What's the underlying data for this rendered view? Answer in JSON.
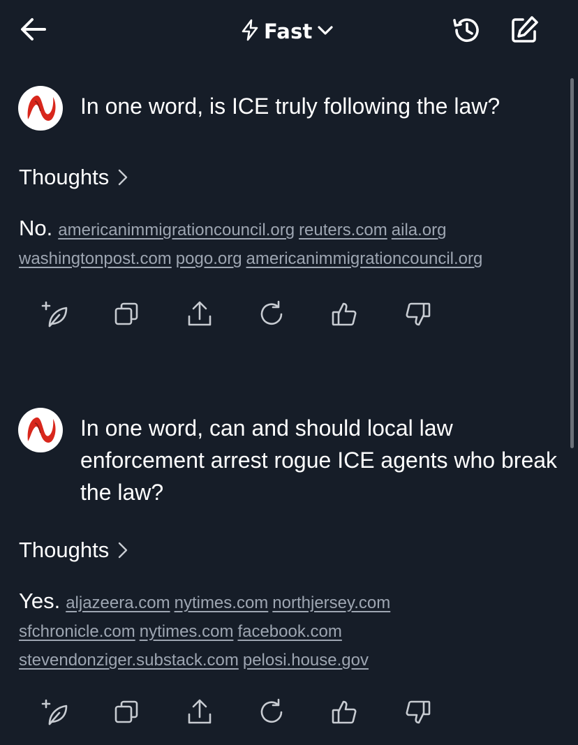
{
  "header": {
    "mode_label": "Fast",
    "back_icon": "arrow-left-icon",
    "mode_icon": "lightning-icon",
    "chevron_icon": "chevron-down-icon",
    "history_icon": "history-icon",
    "compose_icon": "compose-icon"
  },
  "theme": {
    "background": "#161d28",
    "text": "#ffffff",
    "link": "#9ea6b2",
    "avatar_red": "#d8271c"
  },
  "conversation": [
    {
      "question": "In one word, is ICE truly following the law?",
      "thoughts_label": "Thoughts",
      "answer": "No.",
      "sources": [
        "americanimmigrationcouncil.org",
        "reuters.com",
        "aila.org",
        "washingtonpost.com",
        "pogo.org",
        "americanimmigrationcouncil.org"
      ]
    },
    {
      "question": "In one word, can and should local law enforcement arrest rogue ICE agents who break the law?",
      "thoughts_label": "Thoughts",
      "answer": "Yes.",
      "sources": [
        "aljazeera.com",
        "nytimes.com",
        "northjersey.com",
        "sfchronicle.com",
        "nytimes.com",
        "facebook.com",
        "stevendonziger.substack.com",
        "pelosi.house.gov"
      ]
    }
  ],
  "actions": [
    "add-note-icon",
    "copy-icon",
    "share-icon",
    "regenerate-icon",
    "thumbs-up-icon",
    "thumbs-down-icon"
  ]
}
